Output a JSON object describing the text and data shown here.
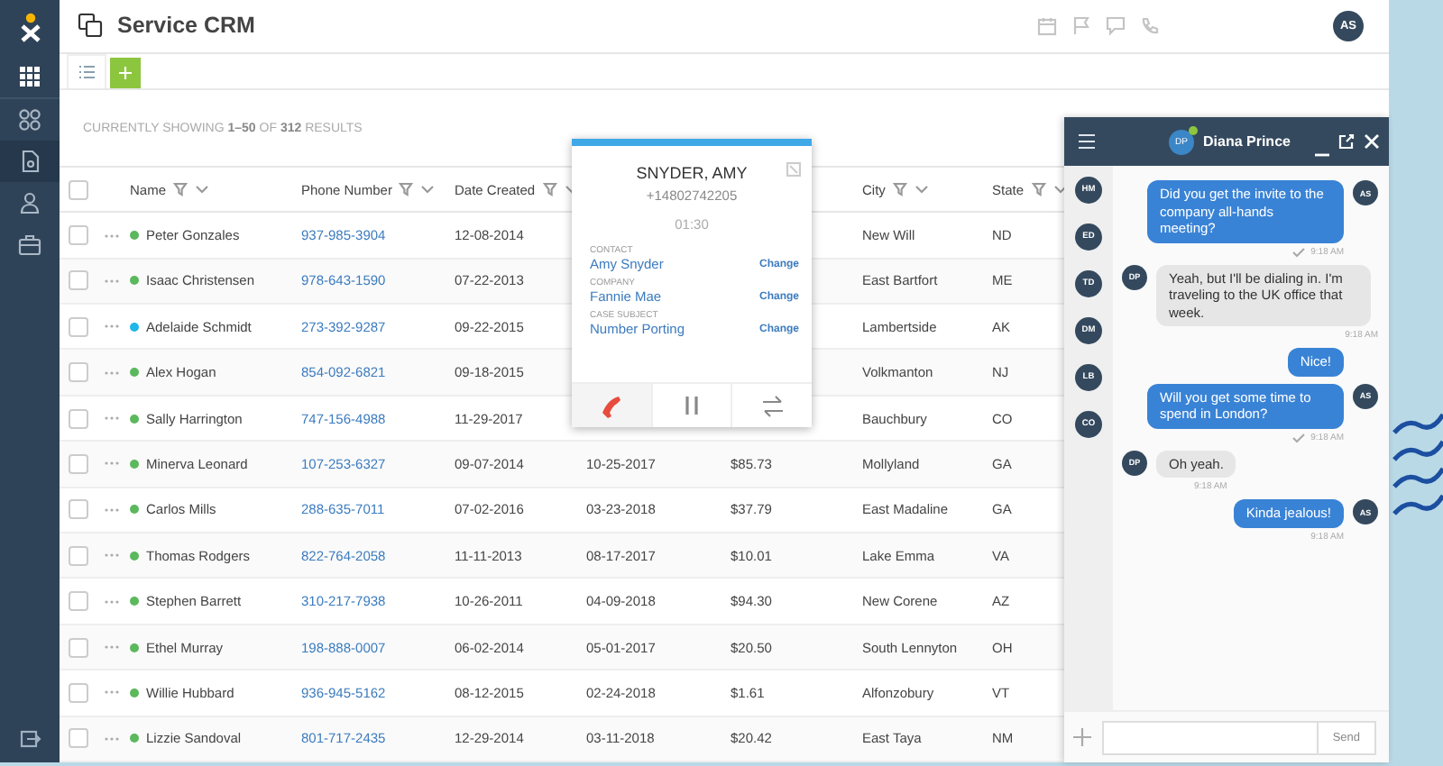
{
  "app": {
    "title": "Service CRM"
  },
  "sidebar": {
    "items": [
      {
        "selected": false
      },
      {
        "selected": false
      },
      {
        "selected": true
      },
      {
        "selected": false
      },
      {
        "selected": false
      }
    ]
  },
  "header": {
    "user_initials": "AS"
  },
  "results": {
    "prefix": "CURRENTLY SHOWING ",
    "range": "1–50",
    "middle": " OF ",
    "total": "312",
    "suffix": " RESULTS"
  },
  "table": {
    "select_all_checked": false,
    "columns": [
      {
        "label": "Name"
      },
      {
        "label": "Phone Number"
      },
      {
        "label": "Date Created"
      },
      {},
      {},
      {
        "label": "City"
      },
      {
        "label": "State"
      }
    ],
    "rows": [
      {
        "name": "Peter Gonzales",
        "checked": false,
        "color": "#5cb85c",
        "phone": "937-985-3904",
        "date_created": "12-08-2014",
        "city": "New Will",
        "state": "ND"
      },
      {
        "name": "Isaac Christensen",
        "checked": false,
        "color": "#5cb85c",
        "phone": "978-643-1590",
        "date_created": "07-22-2013",
        "city": "East Bartfort",
        "state": "ME"
      },
      {
        "name": "Adelaide Schmidt",
        "checked": false,
        "color": "#1fb6e8",
        "phone": "273-392-9287",
        "date_created": "09-22-2015",
        "city": "Lambertside",
        "state": "AK"
      },
      {
        "name": "Alex Hogan",
        "checked": false,
        "color": "#5cb85c",
        "phone": "854-092-6821",
        "date_created": "09-18-2015",
        "city": "Volkmanton",
        "state": "NJ"
      },
      {
        "name": "Sally Harrington",
        "checked": false,
        "color": "#5cb85c",
        "phone": "747-156-4988",
        "date_created": "11-29-2017",
        "city": "Bauchbury",
        "state": "CO"
      },
      {
        "name": "Minerva Leonard",
        "checked": false,
        "color": "#5cb85c",
        "phone": "107-253-6327",
        "date_created": "09-07-2014",
        "column_4": "10-25-2017",
        "column_5": "$85.73",
        "city": "Mollyland",
        "state": "GA"
      },
      {
        "name": "Carlos Mills",
        "checked": false,
        "color": "#5cb85c",
        "phone": "288-635-7011",
        "date_created": "07-02-2016",
        "column_4": "03-23-2018",
        "column_5": "$37.79",
        "city": "East Madaline",
        "state": "GA"
      },
      {
        "name": "Thomas Rodgers",
        "checked": false,
        "color": "#5cb85c",
        "phone": "822-764-2058",
        "date_created": "11-11-2013",
        "column_4": "08-17-2017",
        "column_5": "$10.01",
        "city": "Lake Emma",
        "state": "VA"
      },
      {
        "name": "Stephen Barrett",
        "checked": false,
        "color": "#5cb85c",
        "phone": "310-217-7938",
        "date_created": "10-26-2011",
        "column_4": "04-09-2018",
        "column_5": "$94.30",
        "city": "New Corene",
        "state": "AZ"
      },
      {
        "name": "Ethel Murray",
        "checked": false,
        "color": "#5cb85c",
        "phone": "198-888-0007",
        "date_created": "06-02-2014",
        "column_4": "05-01-2017",
        "column_5": "$20.50",
        "city": "South Lennyton",
        "state": "OH"
      },
      {
        "name": "Willie Hubbard",
        "checked": false,
        "color": "#5cb85c",
        "phone": "936-945-5162",
        "date_created": "08-12-2015",
        "column_4": "02-24-2018",
        "column_5": "$1.61",
        "city": "Alfonzobury",
        "state": "VT"
      },
      {
        "name": "Lizzie Sandoval",
        "checked": false,
        "color": "#5cb85c",
        "phone": "801-717-2435",
        "date_created": "12-29-2014",
        "column_4": "03-11-2018",
        "column_5": "$20.42",
        "city": "East Taya",
        "state": "NM"
      }
    ]
  },
  "call": {
    "name": "SNYDER, AMY",
    "number": "+14802742205",
    "duration": "01:30",
    "fields": [
      {
        "label": "CONTACT",
        "value": "Amy Snyder",
        "action": "Change"
      },
      {
        "label": "COMPANY",
        "value": "Fannie Mae",
        "action": "Change"
      },
      {
        "label": "CASE SUBJECT",
        "value": "Number Porting",
        "action": "Change"
      }
    ]
  },
  "chat": {
    "contact": {
      "initials": "DP",
      "name": "Diana Prince",
      "online": true
    },
    "contacts": [
      "HM",
      "ED",
      "TD",
      "DM",
      "LB",
      "CO"
    ],
    "messages": [
      {
        "kind": "out",
        "initials": "AS",
        "text": "Did you get the invite to the company all-hands meeting?",
        "time": "9:18 AM",
        "read": true
      },
      {
        "kind": "in",
        "initials": "DP",
        "text": "Yeah, but I'll be dialing in. I'm traveling to the UK office that week.",
        "time": "9:18 AM"
      },
      {
        "kind": "out",
        "text": "Nice!"
      },
      {
        "kind": "out",
        "initials": "AS",
        "text": "Will you get some time to spend in London?",
        "time": "9:18 AM",
        "read": true
      },
      {
        "kind": "in",
        "initials": "DP",
        "text": "Oh yeah.",
        "time": "9:18 AM"
      },
      {
        "kind": "out",
        "initials": "AS",
        "text": "Kinda jealous!",
        "time": "9:18 AM",
        "read": false
      }
    ],
    "send_label": "Send"
  }
}
